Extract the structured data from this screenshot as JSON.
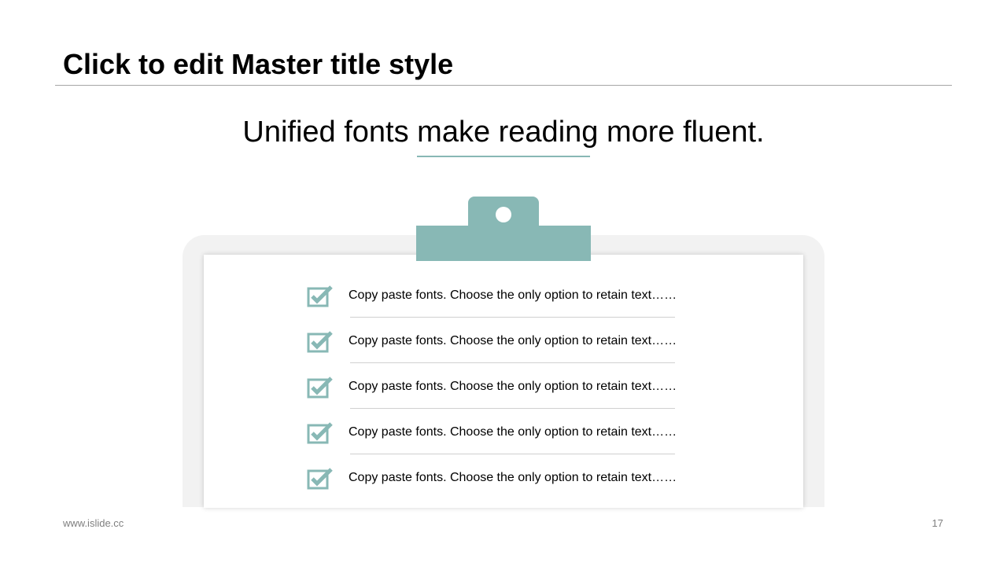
{
  "slide": {
    "master_title": "Click to edit Master title style",
    "subtitle": "Unified fonts make reading more fluent.",
    "accent_color": "#88b8b5",
    "checklist": [
      {
        "text": "Copy paste fonts. Choose the only option to retain text……",
        "icon": "checkbox-checked-icon"
      },
      {
        "text": "Copy paste fonts. Choose the only option to retain text……",
        "icon": "checkbox-checked-icon"
      },
      {
        "text": "Copy paste fonts. Choose the only option to retain text……",
        "icon": "checkbox-checked-icon"
      },
      {
        "text": "Copy paste fonts. Choose the only option to retain text……",
        "icon": "checkbox-checked-icon"
      },
      {
        "text": "Copy paste fonts. Choose the only option to retain text……",
        "icon": "checkbox-checked-icon"
      }
    ],
    "footer": {
      "url": "www.islide.cc",
      "page_number": "17"
    }
  }
}
